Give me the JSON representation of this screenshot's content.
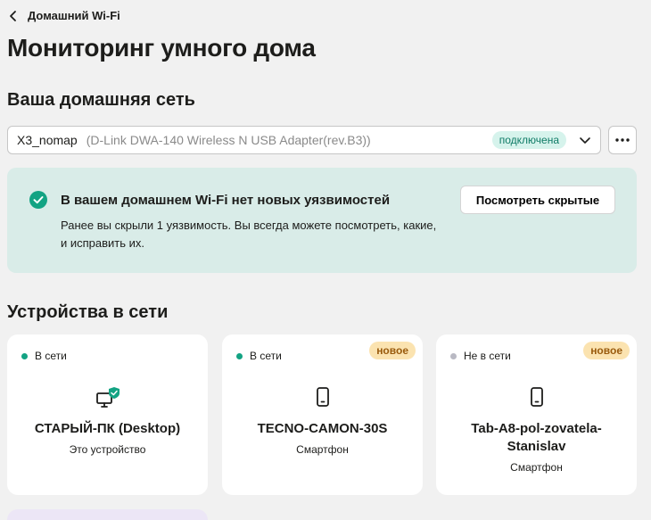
{
  "header": {
    "back_label": "Домашний Wi-Fi",
    "page_title": "Мониторинг умного дома"
  },
  "network": {
    "section_title": "Ваша домашняя сеть",
    "name": "X3_nomap",
    "adapter": "(D-Link DWA-140 Wireless N USB Adapter(rev.B3))",
    "status": "подключена"
  },
  "alert": {
    "title": "В вашем домашнем Wi-Fi нет новых уязвимостей",
    "text": "Ранее вы скрыли 1 уязвимость. Вы всегда можете посмотреть, какие, и исправить их.",
    "button_label": "Посмотреть скрытые"
  },
  "devices": {
    "section_title": "Устройства в сети",
    "items": [
      {
        "status": "В сети",
        "online": true,
        "new": "",
        "name": "СТАРЫЙ-ПК (Desktop)",
        "type": "Это устройство",
        "icon": "desktop-check-icon"
      },
      {
        "status": "В сети",
        "online": true,
        "new": "новое",
        "name": "TECNO-CAMON-30S",
        "type": "Смартфон",
        "icon": "smartphone-icon"
      },
      {
        "status": "Не в сети",
        "online": false,
        "new": "новое",
        "name": "Tab-A8-pol-zovatela-Stanislav",
        "type": "Смартфон",
        "icon": "smartphone-icon"
      }
    ]
  },
  "colors": {
    "accent": "#13a383",
    "alert_bg": "#d9ece8",
    "badge_bg": "#fbe3b0"
  }
}
